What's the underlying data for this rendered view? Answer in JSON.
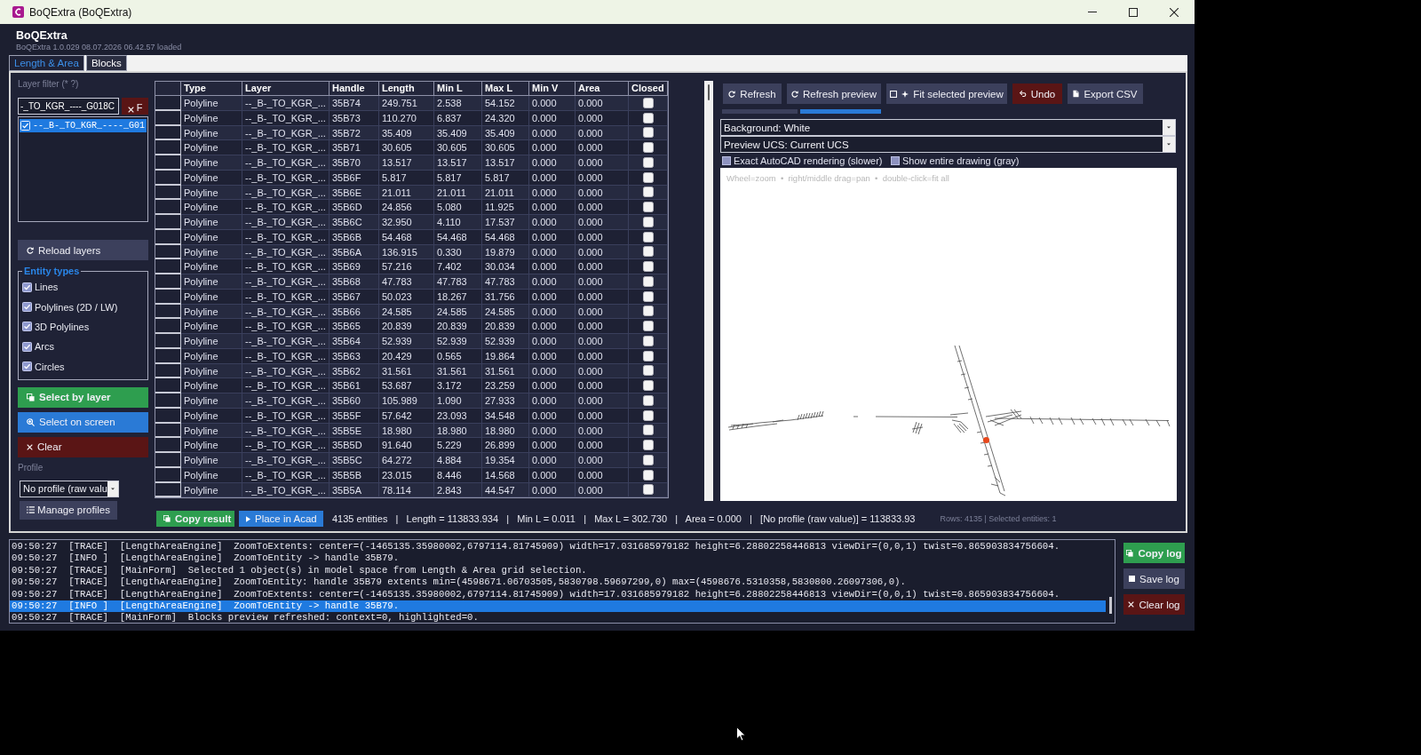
{
  "window": {
    "title": "BoQExtra (BoQExtra)"
  },
  "header": {
    "app_name": "BoQExtra",
    "version_info": "BoQExtra 1.0.029 08.07.2026 06.42.57 loaded"
  },
  "tabs": [
    {
      "label": "Length & Area",
      "selected": true
    },
    {
      "label": "Blocks",
      "selected": false
    }
  ],
  "left_panel": {
    "layer_filter_label": "Layer filter (* ?)",
    "layer_filter": {
      "value": "-_TO_KGR_----_G018C"
    },
    "filter_clear_button": "F",
    "layers": [
      {
        "label": "--_B-_TO_KGR_----_G01",
        "checked": true,
        "selected": true
      }
    ],
    "reload_button": "Reload layers",
    "entity_types": {
      "title": "Entity types",
      "items": [
        {
          "label": "Lines",
          "checked": true
        },
        {
          "label": "Polylines (2D / LW)",
          "checked": true
        },
        {
          "label": "3D Polylines",
          "checked": true
        },
        {
          "label": "Arcs",
          "checked": true
        },
        {
          "label": "Circles",
          "checked": true
        }
      ]
    },
    "actions": [
      {
        "label": "Select by layer",
        "kind": "layer"
      },
      {
        "label": "Select on screen",
        "kind": "screen"
      },
      {
        "label": "Clear",
        "kind": "clear"
      }
    ],
    "profile_label": "Profile",
    "profile_select": {
      "value": "No profile (raw valu"
    },
    "manage_profiles_button": "Manage profiles"
  },
  "table": {
    "columns": [
      "Type",
      "Layer",
      "Handle",
      "Length",
      "Min L",
      "Max L",
      "Min V",
      "Area",
      "Closed"
    ],
    "rows": [
      {
        "cells": [
          "Polyline",
          "--_B-_TO_KGR_...",
          "35B74",
          "249.751",
          "2.538",
          "54.152",
          "0.000",
          "0.000"
        ],
        "closed": false
      },
      {
        "cells": [
          "Polyline",
          "--_B-_TO_KGR_...",
          "35B73",
          "110.270",
          "6.837",
          "24.320",
          "0.000",
          "0.000"
        ],
        "closed": false
      },
      {
        "cells": [
          "Polyline",
          "--_B-_TO_KGR_...",
          "35B72",
          "35.409",
          "35.409",
          "35.409",
          "0.000",
          "0.000"
        ],
        "closed": false
      },
      {
        "cells": [
          "Polyline",
          "--_B-_TO_KGR_...",
          "35B71",
          "30.605",
          "30.605",
          "30.605",
          "0.000",
          "0.000"
        ],
        "closed": false
      },
      {
        "cells": [
          "Polyline",
          "--_B-_TO_KGR_...",
          "35B70",
          "13.517",
          "13.517",
          "13.517",
          "0.000",
          "0.000"
        ],
        "closed": false
      },
      {
        "cells": [
          "Polyline",
          "--_B-_TO_KGR_...",
          "35B6F",
          "5.817",
          "5.817",
          "5.817",
          "0.000",
          "0.000"
        ],
        "closed": false
      },
      {
        "cells": [
          "Polyline",
          "--_B-_TO_KGR_...",
          "35B6E",
          "21.011",
          "21.011",
          "21.011",
          "0.000",
          "0.000"
        ],
        "closed": false
      },
      {
        "cells": [
          "Polyline",
          "--_B-_TO_KGR_...",
          "35B6D",
          "24.856",
          "5.080",
          "11.925",
          "0.000",
          "0.000"
        ],
        "closed": false
      },
      {
        "cells": [
          "Polyline",
          "--_B-_TO_KGR_...",
          "35B6C",
          "32.950",
          "4.110",
          "17.537",
          "0.000",
          "0.000"
        ],
        "closed": false
      },
      {
        "cells": [
          "Polyline",
          "--_B-_TO_KGR_...",
          "35B6B",
          "54.468",
          "54.468",
          "54.468",
          "0.000",
          "0.000"
        ],
        "closed": false
      },
      {
        "cells": [
          "Polyline",
          "--_B-_TO_KGR_...",
          "35B6A",
          "136.915",
          "0.330",
          "19.879",
          "0.000",
          "0.000"
        ],
        "closed": false
      },
      {
        "cells": [
          "Polyline",
          "--_B-_TO_KGR_...",
          "35B69",
          "57.216",
          "7.402",
          "30.034",
          "0.000",
          "0.000"
        ],
        "closed": false
      },
      {
        "cells": [
          "Polyline",
          "--_B-_TO_KGR_...",
          "35B68",
          "47.783",
          "47.783",
          "47.783",
          "0.000",
          "0.000"
        ],
        "closed": false
      },
      {
        "cells": [
          "Polyline",
          "--_B-_TO_KGR_...",
          "35B67",
          "50.023",
          "18.267",
          "31.756",
          "0.000",
          "0.000"
        ],
        "closed": false
      },
      {
        "cells": [
          "Polyline",
          "--_B-_TO_KGR_...",
          "35B66",
          "24.585",
          "24.585",
          "24.585",
          "0.000",
          "0.000"
        ],
        "closed": false
      },
      {
        "cells": [
          "Polyline",
          "--_B-_TO_KGR_...",
          "35B65",
          "20.839",
          "20.839",
          "20.839",
          "0.000",
          "0.000"
        ],
        "closed": false
      },
      {
        "cells": [
          "Polyline",
          "--_B-_TO_KGR_...",
          "35B64",
          "52.939",
          "52.939",
          "52.939",
          "0.000",
          "0.000"
        ],
        "closed": false
      },
      {
        "cells": [
          "Polyline",
          "--_B-_TO_KGR_...",
          "35B63",
          "20.429",
          "0.565",
          "19.864",
          "0.000",
          "0.000"
        ],
        "closed": false
      },
      {
        "cells": [
          "Polyline",
          "--_B-_TO_KGR_...",
          "35B62",
          "31.561",
          "31.561",
          "31.561",
          "0.000",
          "0.000"
        ],
        "closed": false
      },
      {
        "cells": [
          "Polyline",
          "--_B-_TO_KGR_...",
          "35B61",
          "53.687",
          "3.172",
          "23.259",
          "0.000",
          "0.000"
        ],
        "closed": false
      },
      {
        "cells": [
          "Polyline",
          "--_B-_TO_KGR_...",
          "35B60",
          "105.989",
          "1.090",
          "27.933",
          "0.000",
          "0.000"
        ],
        "closed": false
      },
      {
        "cells": [
          "Polyline",
          "--_B-_TO_KGR_...",
          "35B5F",
          "57.642",
          "23.093",
          "34.548",
          "0.000",
          "0.000"
        ],
        "closed": false
      },
      {
        "cells": [
          "Polyline",
          "--_B-_TO_KGR_...",
          "35B5E",
          "18.980",
          "18.980",
          "18.980",
          "0.000",
          "0.000"
        ],
        "closed": false
      },
      {
        "cells": [
          "Polyline",
          "--_B-_TO_KGR_...",
          "35B5D",
          "91.640",
          "5.229",
          "26.899",
          "0.000",
          "0.000"
        ],
        "closed": false
      },
      {
        "cells": [
          "Polyline",
          "--_B-_TO_KGR_...",
          "35B5C",
          "64.272",
          "4.884",
          "19.354",
          "0.000",
          "0.000"
        ],
        "closed": false
      },
      {
        "cells": [
          "Polyline",
          "--_B-_TO_KGR_...",
          "35B5B",
          "23.015",
          "8.446",
          "14.568",
          "0.000",
          "0.000"
        ],
        "closed": false
      },
      {
        "cells": [
          "Polyline",
          "--_B-_TO_KGR_...",
          "35B5A",
          "78.114",
          "2.843",
          "44.547",
          "0.000",
          "0.000"
        ],
        "closed": false
      }
    ]
  },
  "preview": {
    "toolbar": [
      {
        "label": "Refresh",
        "kind": "refresh"
      },
      {
        "label": "Refresh preview",
        "kind": "refresh"
      },
      {
        "label": "Fit selected preview",
        "kind": "fit"
      },
      {
        "label": "Undo",
        "kind": "undo"
      },
      {
        "label": "Export CSV",
        "kind": "export"
      }
    ],
    "indicators": [
      {
        "selected": false
      },
      {
        "selected": true
      }
    ],
    "background_select": {
      "value": "Background: White"
    },
    "ucs_select": {
      "value": "Preview UCS: Current UCS"
    },
    "options": [
      {
        "label": "Exact AutoCAD rendering (slower)",
        "checked": false
      },
      {
        "label": "Show entire drawing (gray)",
        "checked": false
      }
    ],
    "hint": "Wheel=zoom  •  right/middle drag=pan  •  double-click=fit all"
  },
  "result_bar": {
    "buttons": [
      {
        "label": "Copy result",
        "kind": "copy"
      },
      {
        "label": "Place in Acad",
        "kind": "place"
      }
    ],
    "summary": "4135 entities   |   Length = 113833.934   |   Min L = 0.011   |   Max L = 302.730   |   Area = 0.000   |   [No profile (raw value)] = 113833.93",
    "status": "Rows: 4135 | Selected entities: 1"
  },
  "log": {
    "lines": [
      {
        "text": "09:50:27  [TRACE]  [LengthAreaEngine]  ZoomToExtents: center=(-1465135.35980002,6797114.81745909) width=17.031685979182 height=6.28802258446813 viewDir=(0,0,1) twist=0.865903834756604.",
        "selected": false
      },
      {
        "text": "09:50:27  [INFO ]  [LengthAreaEngine]  ZoomToEntity -> handle 35B79.",
        "selected": false
      },
      {
        "text": "09:50:27  [TRACE]  [MainForm]  Selected 1 object(s) in model space from Length & Area grid selection.",
        "selected": false
      },
      {
        "text": "09:50:27  [TRACE]  [LengthAreaEngine]  ZoomToEntity: handle 35B79 extents min=(4598671.06703505,5830798.59697299,0) max=(4598676.5310358,5830800.26097306,0).",
        "selected": false
      },
      {
        "text": "09:50:27  [TRACE]  [LengthAreaEngine]  ZoomToExtents: center=(-1465135.35980002,6797114.81745909) width=17.031685979182 height=6.28802258446813 viewDir=(0,0,1) twist=0.865903834756604.",
        "selected": false
      },
      {
        "text": "09:50:27  [INFO ]  [LengthAreaEngine]  ZoomToEntity -> handle 35B79.",
        "selected": true
      },
      {
        "text": "09:50:27  [TRACE]  [MainForm]  Blocks preview refreshed: context=0, highlighted=0.",
        "selected": false
      }
    ],
    "buttons": [
      {
        "label": "Copy log",
        "kind": "copy"
      },
      {
        "label": "Save log",
        "kind": "save"
      },
      {
        "label": "Clear log",
        "kind": "clear"
      }
    ]
  }
}
